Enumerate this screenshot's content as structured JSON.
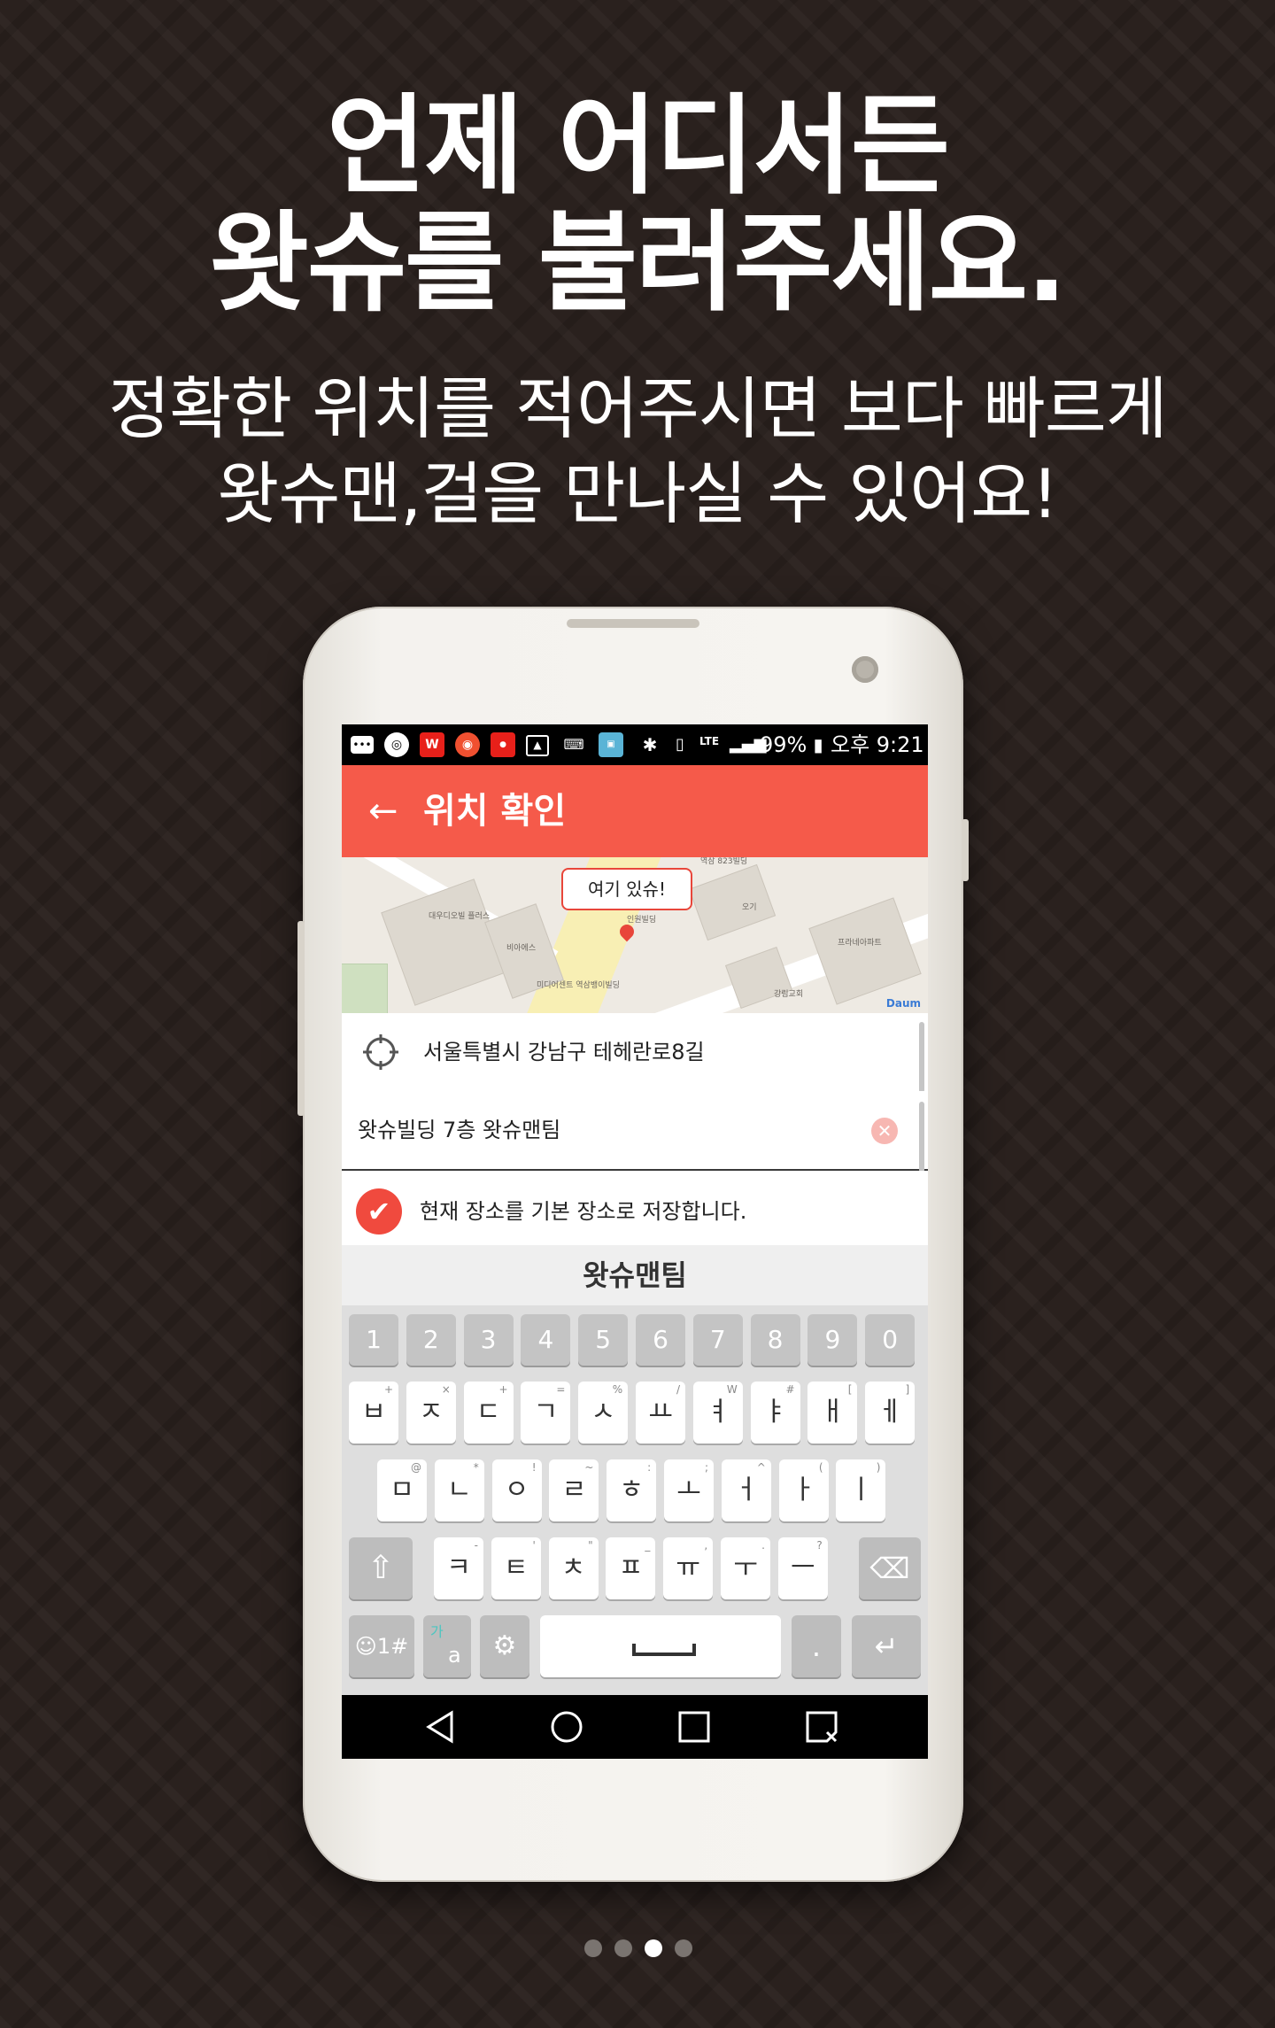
{
  "promo": {
    "title_line1": "언제 어디서든",
    "title_line2": "왓슈를 불러주세요.",
    "subtitle_line1": "정확한 위치를 적어주시면 보다 빠르게",
    "subtitle_line2": "왓슈맨,걸을 만나실 수 있어요!"
  },
  "status_bar": {
    "battery": "99%",
    "time": "오후 9:21",
    "network": "LTE",
    "icons": [
      "chat-icon",
      "app-icon",
      "w-app-icon",
      "record-icon",
      "coupon-icon",
      "image-icon",
      "keyboard-icon",
      "app-card-icon",
      "bluetooth-icon",
      "vibrate-icon",
      "signal-icon",
      "battery-icon"
    ]
  },
  "app_bar": {
    "title": "위치 확인",
    "back_icon": "arrow-left-icon",
    "color": "#f55a4a"
  },
  "map": {
    "bubble_label": "여기 있슈!",
    "labels": [
      "역삼 823빌딩",
      "대우디오빌 플러스",
      "비아에스",
      "미디어센트 역삼뱅이빌딩",
      "인원빌딩",
      "프라네아파트",
      "강림교회",
      "오기"
    ],
    "brand": "Daum"
  },
  "address": {
    "icon": "crosshair-icon",
    "text": "서울특별시 강남구 테헤란로8길"
  },
  "detail_input": {
    "value": "왓슈빌딩 7층 왓슈맨팀",
    "clear_icon": "clear-icon"
  },
  "save_default": {
    "checked": true,
    "label": "현재 장소를 기본 장소로 저장합니다."
  },
  "keyboard": {
    "prediction": "왓슈맨팀",
    "number_row": [
      "1",
      "2",
      "3",
      "4",
      "5",
      "6",
      "7",
      "8",
      "9",
      "0"
    ],
    "row1": [
      {
        "k": "ㅂ",
        "s": "+"
      },
      {
        "k": "ㅈ",
        "s": "×"
      },
      {
        "k": "ㄷ",
        "s": "+"
      },
      {
        "k": "ㄱ",
        "s": "="
      },
      {
        "k": "ㅅ",
        "s": "%"
      },
      {
        "k": "ㅛ",
        "s": "/"
      },
      {
        "k": "ㅕ",
        "s": "W"
      },
      {
        "k": "ㅑ",
        "s": "#"
      },
      {
        "k": "ㅐ",
        "s": "["
      },
      {
        "k": "ㅔ",
        "s": "]"
      }
    ],
    "row2": [
      {
        "k": "ㅁ",
        "s": "@"
      },
      {
        "k": "ㄴ",
        "s": "*"
      },
      {
        "k": "ㅇ",
        "s": "!"
      },
      {
        "k": "ㄹ",
        "s": "~"
      },
      {
        "k": "ㅎ",
        "s": ":"
      },
      {
        "k": "ㅗ",
        "s": ";"
      },
      {
        "k": "ㅓ",
        "s": "^"
      },
      {
        "k": "ㅏ",
        "s": "("
      },
      {
        "k": "ㅣ",
        "s": ")"
      }
    ],
    "row3": [
      {
        "k": "ㅋ",
        "s": "-"
      },
      {
        "k": "ㅌ",
        "s": "'"
      },
      {
        "k": "ㅊ",
        "s": "\""
      },
      {
        "k": "ㅍ",
        "s": "_"
      },
      {
        "k": "ㅠ",
        "s": ","
      },
      {
        "k": "ㅜ",
        "s": "."
      },
      {
        "k": "ㅡ",
        "s": "?"
      }
    ],
    "emoji_key": "☺1#",
    "lang_key_top": "가",
    "lang_key_bottom": "a",
    "period_key": "."
  },
  "pager": {
    "count": 4,
    "active_index": 2
  }
}
